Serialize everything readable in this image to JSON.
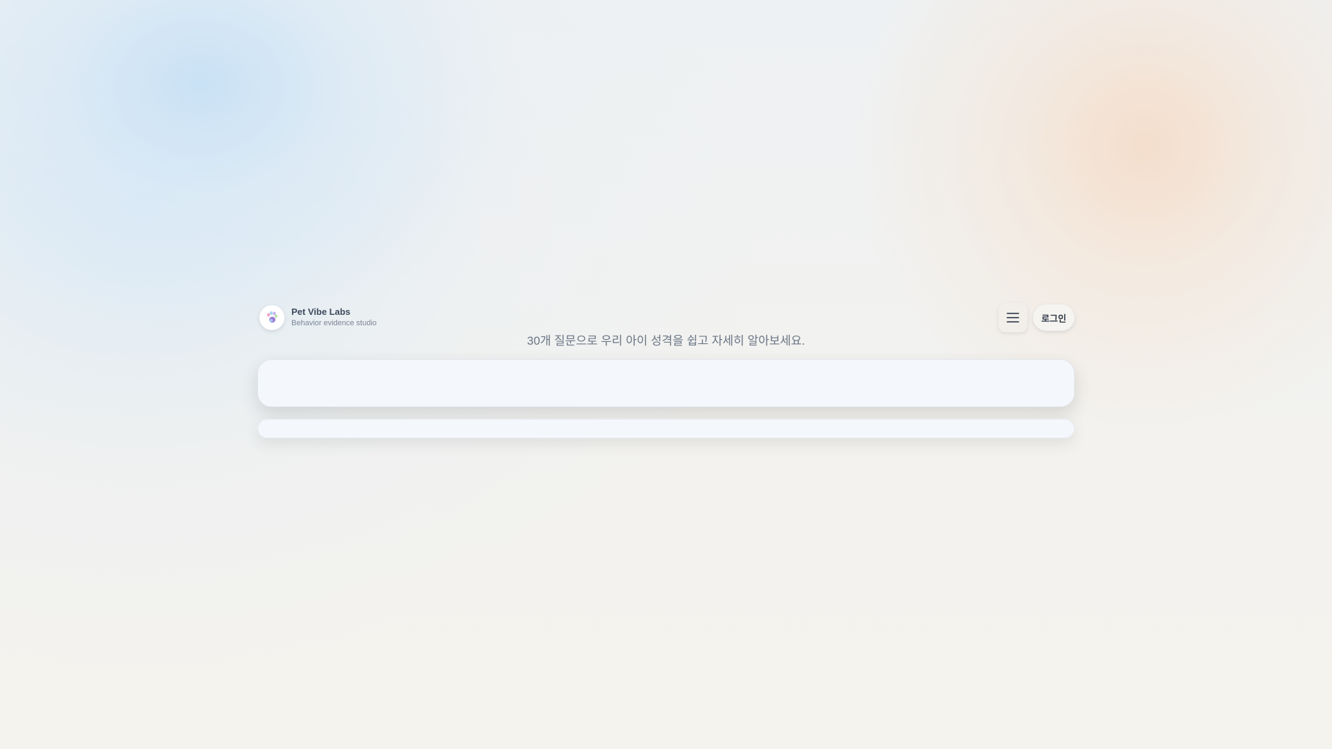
{
  "brand": {
    "name": "Pet Vibe Labs",
    "tagline": "Behavior evidence studio",
    "logo_icon": "paw-icon",
    "logo_colors": [
      "#f4a8c8",
      "#a8d8f0",
      "#c8b4f0",
      "#b8e6a0",
      "#9a7ad8"
    ]
  },
  "header": {
    "menu_icon": "hamburger-menu-icon",
    "login_label": "로그인"
  },
  "main": {
    "subtitle": "30개 질문으로 우리 아이 성격을 쉽고 자세히 알아보세요."
  }
}
